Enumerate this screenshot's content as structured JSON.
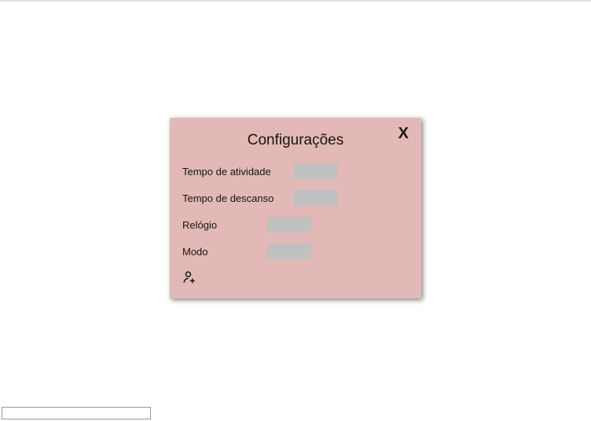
{
  "modal": {
    "title": "Configurações",
    "close_label": "X",
    "fields": {
      "activity_time": {
        "label": "Tempo de atividade",
        "value": ""
      },
      "rest_time": {
        "label": "Tempo de descanso",
        "value": ""
      },
      "clock": {
        "label": "Relógio",
        "value": ""
      },
      "mode": {
        "label": "Modo",
        "value": ""
      }
    },
    "add_user_icon": "add-user-icon"
  },
  "bottom_input": {
    "value": ""
  }
}
